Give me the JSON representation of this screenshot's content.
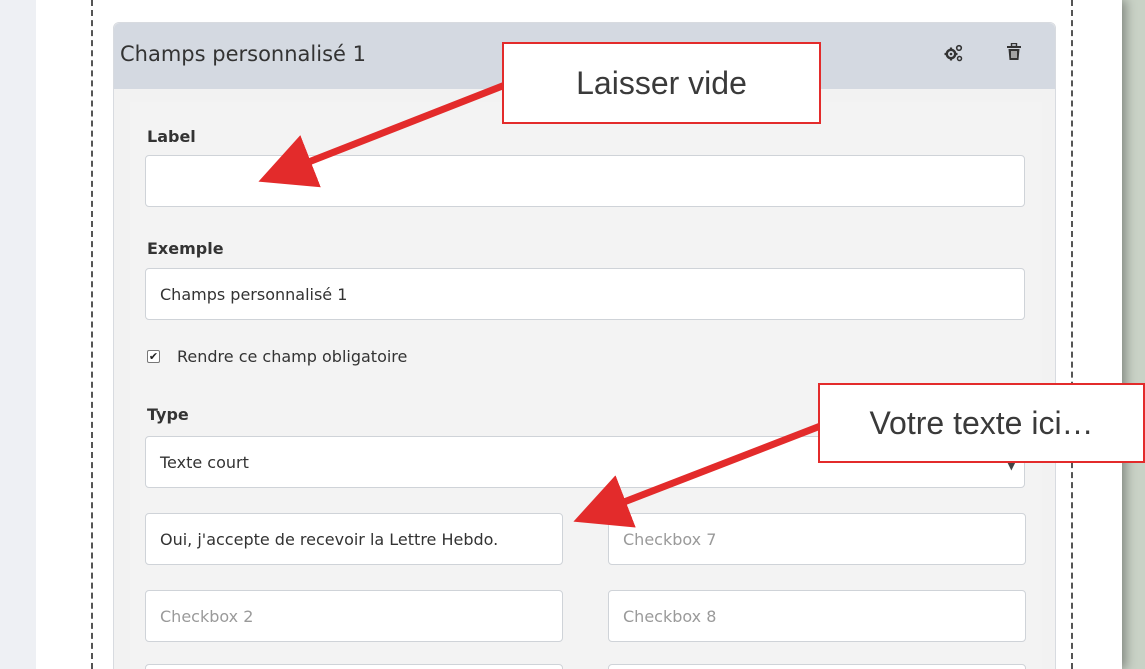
{
  "panel": {
    "title": "Champs personnalisé 1",
    "settings_icon": "gears-icon",
    "delete_icon": "trash-icon"
  },
  "form": {
    "label_heading": "Label",
    "label_value": "",
    "example_heading": "Exemple",
    "example_value": "Champs personnalisé 1",
    "required_label": "Rendre ce champ obligatoire",
    "required_checked": true,
    "type_heading": "Type",
    "type_value": "Texte court",
    "checkboxes": {
      "cb1_value": "Oui, j'accepte de recevoir la Lettre Hebdo.",
      "cb2_placeholder": "Checkbox 2",
      "cb7_placeholder": "Checkbox 7",
      "cb8_placeholder": "Checkbox 8"
    }
  },
  "annotations": {
    "callout1": "Laisser vide",
    "callout2": "Votre texte ici…",
    "color": "#e32b2b"
  }
}
